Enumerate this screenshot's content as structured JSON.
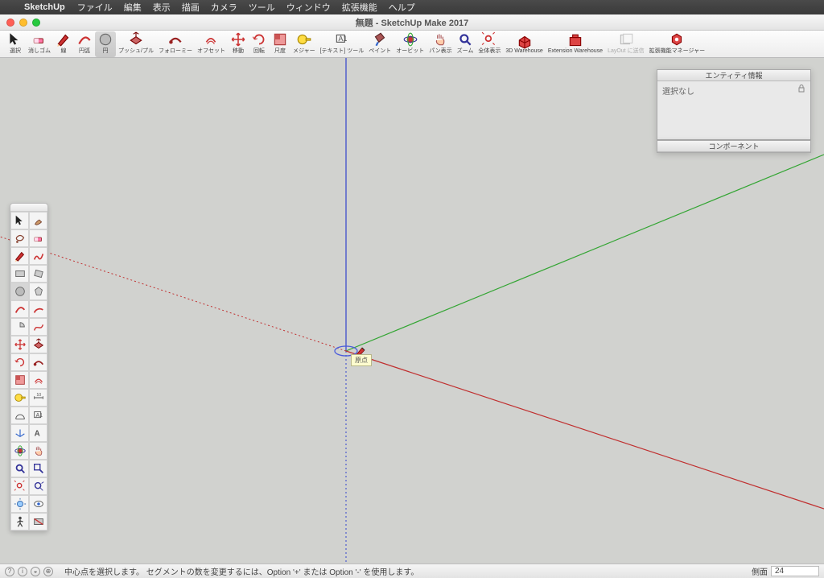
{
  "menubar": {
    "apple": "",
    "app": "SketchUp",
    "items": [
      "ファイル",
      "編集",
      "表示",
      "描画",
      "カメラ",
      "ツール",
      "ウィンドウ",
      "拡張機能",
      "ヘルプ"
    ]
  },
  "window": {
    "title": "無題 - SketchUp Make 2017"
  },
  "htoolbar": [
    {
      "name": "select",
      "label": "選択",
      "icon": "arrow"
    },
    {
      "name": "eraser",
      "label": "消しゴム",
      "icon": "eraser"
    },
    {
      "name": "line",
      "label": "線",
      "icon": "pencil"
    },
    {
      "name": "arc",
      "label": "円弧",
      "icon": "arc"
    },
    {
      "name": "shapes",
      "label": "円",
      "icon": "circle",
      "active": true
    },
    {
      "name": "pushpull",
      "label": "プッシュ/プル",
      "icon": "pushpull"
    },
    {
      "name": "followme",
      "label": "フォローミー",
      "icon": "followme"
    },
    {
      "name": "offset",
      "label": "オフセット",
      "icon": "offset"
    },
    {
      "name": "move",
      "label": "移動",
      "icon": "move"
    },
    {
      "name": "rotate",
      "label": "回転",
      "icon": "rotate"
    },
    {
      "name": "scale",
      "label": "尺度",
      "icon": "scale"
    },
    {
      "name": "tape",
      "label": "メジャー",
      "icon": "tape"
    },
    {
      "name": "text",
      "label": "[テキスト] ツール",
      "icon": "text"
    },
    {
      "name": "paint",
      "label": "ペイント",
      "icon": "paint"
    },
    {
      "name": "orbit",
      "label": "オービット",
      "icon": "orbit"
    },
    {
      "name": "pan",
      "label": "パン表示",
      "icon": "pan"
    },
    {
      "name": "zoom",
      "label": "ズーム",
      "icon": "zoom"
    },
    {
      "name": "zoomext",
      "label": "全体表示",
      "icon": "zoomext"
    },
    {
      "name": "3dwh",
      "label": "3D Warehouse",
      "icon": "3dwh"
    },
    {
      "name": "extwh",
      "label": "Extension Warehouse",
      "icon": "extwh"
    },
    {
      "name": "layout",
      "label": "LayOut に送信",
      "icon": "layout",
      "disabled": true
    },
    {
      "name": "extmgr",
      "label": "拡張機能マネージャー",
      "icon": "extmgr"
    }
  ],
  "palette_rows": [
    [
      "arrow",
      "brush"
    ],
    [
      "lasso",
      "eraser"
    ],
    [
      "pencil",
      "freehand"
    ],
    [
      "rect",
      "rotrect"
    ],
    [
      "circle",
      "poly"
    ],
    [
      "arc",
      "arc2"
    ],
    [
      "pie",
      "curve"
    ],
    [
      "move",
      "pushpull"
    ],
    [
      "rotate",
      "followme"
    ],
    [
      "scale",
      "offset"
    ],
    [
      "tape",
      "dim"
    ],
    [
      "protractor",
      "text"
    ],
    [
      "axes",
      "3dtext"
    ],
    [
      "orbit",
      "pan"
    ],
    [
      "zoom",
      "zoomwin"
    ],
    [
      "zoomext",
      "prev"
    ],
    [
      "position",
      "look"
    ],
    [
      "walk",
      "section"
    ]
  ],
  "panels": {
    "entity": {
      "title": "エンティティ情報",
      "body": "選択なし"
    },
    "component": {
      "title": "コンポーネント"
    }
  },
  "origin_tip": "原点",
  "status": {
    "hint": "中心点を選択します。 セグメントの数を変更するには、Option '+' または Option '-' を使用します。",
    "measure_label": "側面",
    "measure_value": "24"
  },
  "colors": {
    "red_axis": "#c03030",
    "green_axis": "#33a533",
    "blue_axis": "#3344cc",
    "origin_ellipse": "#4a5bdc"
  }
}
